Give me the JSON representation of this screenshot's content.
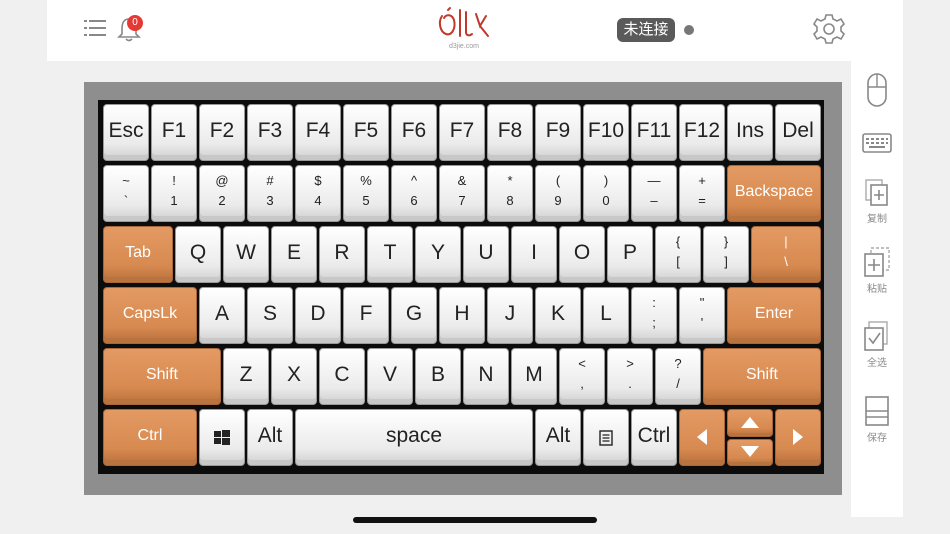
{
  "header": {
    "notification_count": "0",
    "logo_subtext": "d3jie.com",
    "status": "未连接"
  },
  "sidebar": {
    "copy_label": "复制",
    "paste_label": "粘贴",
    "select_all_label": "全选",
    "save_label": "保存"
  },
  "keyboard": {
    "row1": [
      "Esc",
      "F1",
      "F2",
      "F3",
      "F4",
      "F5",
      "F6",
      "F7",
      "F8",
      "F9",
      "F10",
      "F11",
      "F12",
      "Ins",
      "Del"
    ],
    "row2": [
      {
        "top": "~",
        "bottom": "`"
      },
      {
        "top": "!",
        "bottom": "1"
      },
      {
        "top": "@",
        "bottom": "2"
      },
      {
        "top": "#",
        "bottom": "3"
      },
      {
        "top": "$",
        "bottom": "4"
      },
      {
        "top": "%",
        "bottom": "5"
      },
      {
        "top": "^",
        "bottom": "6"
      },
      {
        "top": "&",
        "bottom": "7"
      },
      {
        "top": "*",
        "bottom": "8"
      },
      {
        "top": "(",
        "bottom": "9"
      },
      {
        "top": ")",
        "bottom": "0"
      },
      {
        "top": "—",
        "bottom": "–"
      },
      {
        "top": "+",
        "bottom": "="
      },
      {
        "label": "Backspace"
      }
    ],
    "row3": [
      {
        "label": "Tab"
      },
      {
        "label": "Q"
      },
      {
        "label": "W"
      },
      {
        "label": "E"
      },
      {
        "label": "R"
      },
      {
        "label": "T"
      },
      {
        "label": "Y"
      },
      {
        "label": "U"
      },
      {
        "label": "I"
      },
      {
        "label": "O"
      },
      {
        "label": "P"
      },
      {
        "top": "{",
        "bottom": "["
      },
      {
        "top": "}",
        "bottom": "]"
      },
      {
        "top": "|",
        "bottom": "\\"
      }
    ],
    "row4": [
      {
        "label": "CapsLk"
      },
      {
        "label": "A"
      },
      {
        "label": "S"
      },
      {
        "label": "D"
      },
      {
        "label": "F"
      },
      {
        "label": "G"
      },
      {
        "label": "H"
      },
      {
        "label": "J"
      },
      {
        "label": "K"
      },
      {
        "label": "L"
      },
      {
        "top": ":",
        "bottom": ";"
      },
      {
        "top": "\"",
        "bottom": "'"
      },
      {
        "label": "Enter"
      }
    ],
    "row5": [
      {
        "label": "Shift"
      },
      {
        "label": "Z"
      },
      {
        "label": "X"
      },
      {
        "label": "C"
      },
      {
        "label": "V"
      },
      {
        "label": "B"
      },
      {
        "label": "N"
      },
      {
        "label": "M"
      },
      {
        "top": "<",
        "bottom": ","
      },
      {
        "top": ">",
        "bottom": "."
      },
      {
        "top": "?",
        "bottom": "/"
      },
      {
        "label": "Shift"
      }
    ],
    "row6": [
      {
        "label": "Ctrl"
      },
      {
        "label": ""
      },
      {
        "label": "Alt"
      },
      {
        "label": "space"
      },
      {
        "label": "Alt"
      },
      {
        "label": ""
      },
      {
        "label": "Ctrl"
      }
    ]
  },
  "icons": [
    "menu-list-icon",
    "bell-icon",
    "gear-icon",
    "mouse-icon",
    "keyboard-icon",
    "copy-icon",
    "paste-icon",
    "select-all-icon",
    "save-icon",
    "windows-icon",
    "context-menu-icon",
    "arrow-left-icon",
    "arrow-up-icon",
    "arrow-down-icon",
    "arrow-right-icon"
  ],
  "colors": {
    "accent": "#d88a50",
    "status_bg": "#5a5a5a",
    "badge": "#e53935",
    "logo": "#c0392b"
  }
}
